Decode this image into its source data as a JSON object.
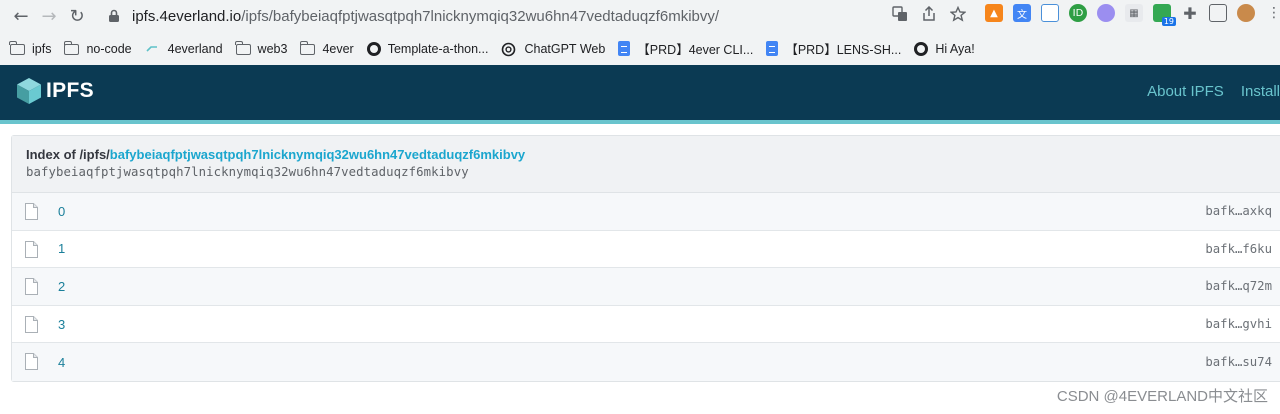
{
  "browser": {
    "url_host": "ipfs.4everland.io",
    "url_path": "/ipfs/bafybeiaqfptjwasqtpqh7lnicknymqiq32wu6hn47vedtaduqzf6mkibvy/",
    "extension_badge": "19"
  },
  "bookmarks": [
    {
      "label": "ipfs",
      "icon": "folder-icon"
    },
    {
      "label": "no-code",
      "icon": "folder-icon"
    },
    {
      "label": "4everland",
      "icon": "4everland-icon"
    },
    {
      "label": "web3",
      "icon": "folder-icon"
    },
    {
      "label": "4ever",
      "icon": "folder-icon"
    },
    {
      "label": "Template-a-thon...",
      "icon": "globe-icon"
    },
    {
      "label": "ChatGPT Web",
      "icon": "chatgpt-icon"
    },
    {
      "label": "【PRD】4ever CLI...",
      "icon": "doc-icon"
    },
    {
      "label": "【PRD】LENS-SH...",
      "icon": "doc-icon"
    },
    {
      "label": "Hi Aya!",
      "icon": "globe-icon"
    }
  ],
  "header": {
    "title": "IPFS",
    "nav": [
      "About IPFS",
      "Install"
    ]
  },
  "listing": {
    "index_prefix": "Index of /ipfs/",
    "cid": "bafybeiaqfptjwasqtpqh7lnicknymqiq32wu6hn47vedtaduqzf6mkibvy",
    "cid_plain": "bafybeiaqfptjwasqtpqh7lnicknymqiq32wu6hn47vedtaduqzf6mkibvy",
    "rows": [
      {
        "name": "0",
        "hash": "bafk…axkq"
      },
      {
        "name": "1",
        "hash": "bafk…f6ku"
      },
      {
        "name": "2",
        "hash": "bafk…q72m"
      },
      {
        "name": "3",
        "hash": "bafk…gvhi"
      },
      {
        "name": "4",
        "hash": "bafk…su74"
      }
    ]
  },
  "watermark": "CSDN @4EVERLAND中文社区",
  "colors": {
    "header_bg": "#0b3a53",
    "accent": "#69c4cd",
    "link": "#1ba6ce"
  }
}
